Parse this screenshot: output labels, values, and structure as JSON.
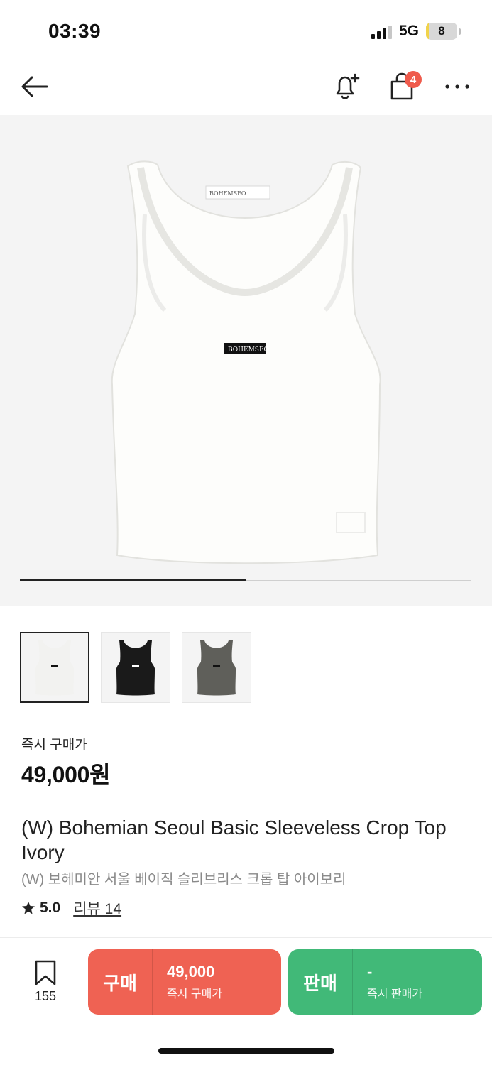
{
  "status_bar": {
    "time": "03:39",
    "network": "5G",
    "battery": "8",
    "battery_fraction": 0.08
  },
  "nav": {
    "cart_badge": "4"
  },
  "product_image": {
    "description_icon": "tank-top-image",
    "brand_tag": "BOHEMSEO",
    "slide_progress": 0.5
  },
  "thumbnails": [
    {
      "color": "#f2f2f0",
      "active": true
    },
    {
      "color": "#1a1a1a",
      "active": false
    },
    {
      "color": "#5f5f5a",
      "active": false
    }
  ],
  "price": {
    "label": "즉시 구매가",
    "value": "49,000원"
  },
  "product": {
    "title_en": "(W) Bohemian Seoul Basic Sleeveless Crop Top Ivory",
    "title_ko": "(W) 보헤미안 서울 베이직 슬리브리스 크롭 탑 아이보리",
    "rating": "5.0",
    "review_label": "리뷰 14"
  },
  "bottom_bar": {
    "wish_count": "155",
    "buy": {
      "label": "구매",
      "price": "49,000",
      "sub": "즉시 구매가",
      "color": "#ef6253"
    },
    "sell": {
      "label": "판매",
      "price": "-",
      "sub": "즉시 판매가",
      "color": "#41b978"
    }
  }
}
